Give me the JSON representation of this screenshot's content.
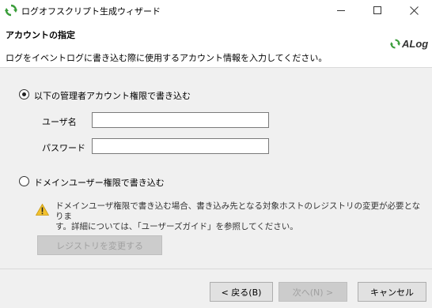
{
  "window": {
    "title": "ログオフスクリプト生成ウィザード"
  },
  "header": {
    "title": "アカウントの指定",
    "description": "ログをイベントログに書き込む際に使用するアカウント情報を入力してください。",
    "logo_text": "ALog"
  },
  "options": {
    "admin": {
      "label": "以下の管理者アカウント権限で書き込む",
      "selected": true
    },
    "domain": {
      "label": "ドメインユーザー権限で書き込む",
      "selected": false
    }
  },
  "fields": {
    "username": {
      "label": "ユーザ名",
      "value": ""
    },
    "password": {
      "label": "パスワード",
      "value": ""
    }
  },
  "warning": {
    "icon": "warning-triangle-icon",
    "line1": "ドメインユーザ権限で書き込む場合、書き込み先となる対象ホストのレジストリの変更が必要となりま",
    "line2": "す。詳細については、「ユーザーズガイド」を参照してください。"
  },
  "buttons": {
    "registry": "レジストリを変更する",
    "back": "< 戻る(B)",
    "next": "次へ(N) >",
    "cancel": "キャンセル"
  },
  "colors": {
    "logo_green": "#3a9d3a",
    "warning_yellow": "#f2c12e"
  }
}
